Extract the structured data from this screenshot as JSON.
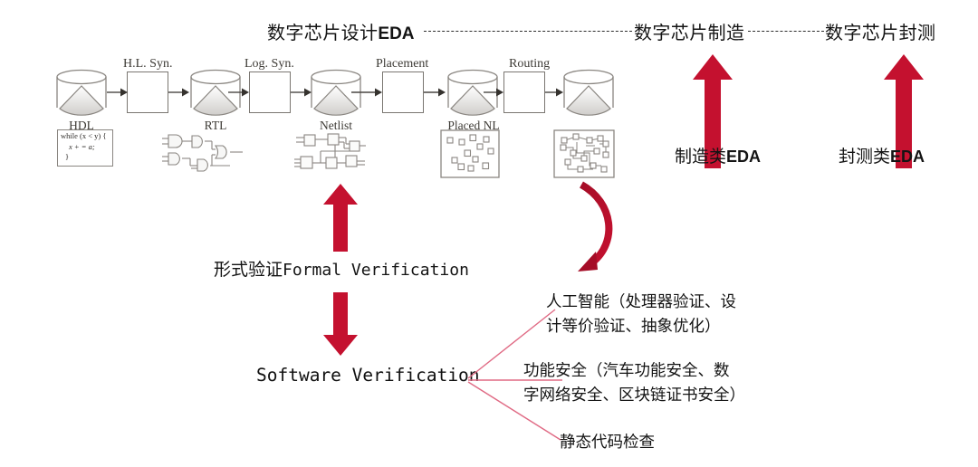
{
  "diagram": {
    "title_row": [
      {
        "cjk": "数字芯片设计",
        "lat": "EDA",
        "name": "digital-chip-design-eda"
      },
      {
        "cjk": "数字芯片制造",
        "lat": "",
        "name": "digital-chip-manufacturing"
      },
      {
        "cjk": "数字芯片封测",
        "lat": "",
        "name": "digital-chip-packaging-test"
      }
    ],
    "pipeline": {
      "stages": [
        {
          "label": "H.L. Syn.",
          "name": "stage-hl-syn"
        },
        {
          "label": "Log. Syn.",
          "name": "stage-log-syn"
        },
        {
          "label": "Placement",
          "name": "stage-placement"
        },
        {
          "label": "Routing",
          "name": "stage-routing"
        }
      ],
      "nodes": [
        {
          "label": "HDL",
          "name": "node-hdl"
        },
        {
          "label": "RTL",
          "name": "node-rtl"
        },
        {
          "label": "Netlist",
          "name": "node-netlist"
        },
        {
          "label": "Placed NL",
          "name": "node-placed-nl"
        },
        {
          "label": "",
          "name": "node-routed-nl"
        }
      ],
      "hdl_code": {
        "line1": "while (x < y) {",
        "line2": "x + = a;",
        "line3": "}"
      }
    },
    "vertical_arrows": [
      {
        "label_cjk": "制造类",
        "label_lat": "EDA",
        "name": "manufacturing-eda"
      },
      {
        "label_cjk": "封测类",
        "label_lat": "EDA",
        "name": "packaging-test-eda"
      }
    ],
    "verification": {
      "formal_cjk": "形式验证",
      "formal_lat": "Formal Verification",
      "software": "Software Verification"
    },
    "annotations": [
      {
        "text": "人工智能（处理器验证、设\n计等价验证、抽象优化）",
        "name": "annotation-ai"
      },
      {
        "text": "功能安全（汽车功能安全、数\n字网络安全、区块链证书安全）",
        "name": "annotation-functional-safety"
      },
      {
        "text": "静态代码检查",
        "name": "annotation-static-code-check"
      }
    ],
    "colors": {
      "red": "#C4112F",
      "red_dark": "#A50D27",
      "connector_pink": "#E8728C",
      "outline_gray": "#7a7671",
      "text_dark": "#141414"
    }
  }
}
